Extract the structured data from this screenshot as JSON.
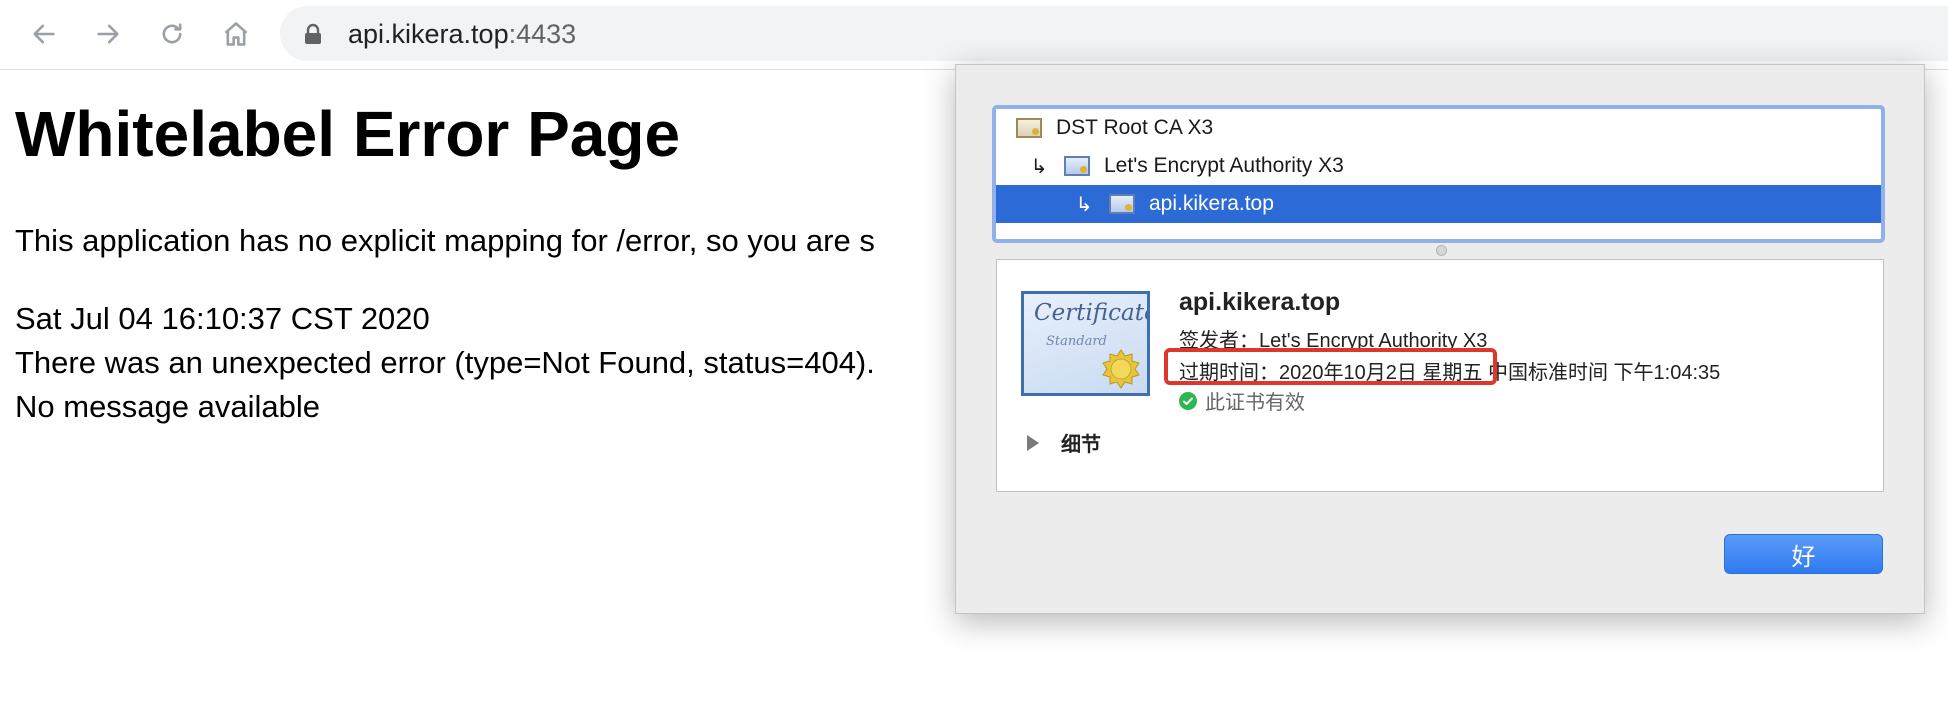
{
  "browser": {
    "url_host": "api.kikera.top",
    "url_port": ":4433",
    "icons": [
      "back-arrow-icon",
      "forward-arrow-icon",
      "reload-icon",
      "home-icon",
      "lock-icon"
    ]
  },
  "page": {
    "title": "Whitelabel Error Page",
    "message": "This application has no explicit mapping for /error, so you are s",
    "timestamp": "Sat Jul 04 16:10:37 CST 2020",
    "error": "There was an unexpected error (type=Not Found, status=404).",
    "detail": "No message available"
  },
  "certificate_sheet": {
    "chain": [
      {
        "label": "DST Root CA X3",
        "arrow": ""
      },
      {
        "label": "Let's Encrypt Authority X3",
        "arrow": "↳"
      },
      {
        "label": "api.kikera.top",
        "arrow": "↳",
        "selected": true
      }
    ],
    "image_text": "Certificate",
    "image_subtext": "Standard",
    "name": "api.kikera.top",
    "issuer": "签发者：Let's Encrypt Authority X3",
    "expiry": "过期时间：2020年10月2日 星期五 中国标准时间 下午1:04:35",
    "validity": "此证书有效",
    "details_label": "细节",
    "ok_label": "好",
    "colors": {
      "selected_row": "#2c6ad5",
      "highlight": "#e0352b",
      "button": "#2f7af0",
      "valid_check": "#2db84f"
    }
  }
}
